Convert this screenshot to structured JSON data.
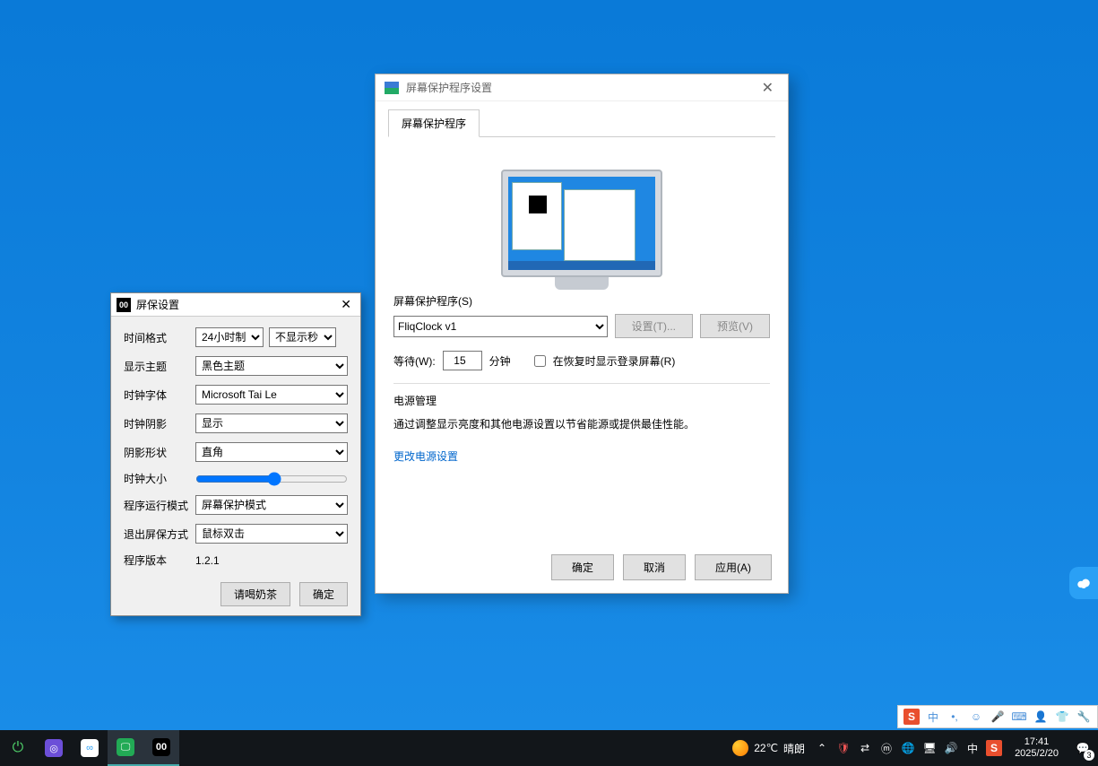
{
  "small_dialog": {
    "title": "屏保设置",
    "icon_text": "00",
    "rows": {
      "time_format": {
        "label": "时间格式",
        "value1": "24小时制",
        "value2": "不显示秒"
      },
      "theme": {
        "label": "显示主题",
        "value": "黑色主题"
      },
      "font": {
        "label": "时钟字体",
        "value": "Microsoft Tai Le"
      },
      "shadow": {
        "label": "时钟阴影",
        "value": "显示"
      },
      "shadow_shape": {
        "label": "阴影形状",
        "value": "直角"
      },
      "size": {
        "label": "时钟大小"
      },
      "run_mode": {
        "label": "程序运行模式",
        "value": "屏幕保护模式"
      },
      "exit_mode": {
        "label": "退出屏保方式",
        "value": "鼠标双击"
      },
      "version": {
        "label": "程序版本",
        "value": "1.2.1"
      }
    },
    "buttons": {
      "tea": "请喝奶茶",
      "ok": "确定"
    }
  },
  "win_dialog": {
    "title": "屏幕保护程序设置",
    "tab": "屏幕保护程序",
    "saver": {
      "label": "屏幕保护程序(S)",
      "selected": "FliqClock v1",
      "settings_btn": "设置(T)...",
      "preview_btn": "预览(V)"
    },
    "wait": {
      "label": "等待(W):",
      "value": "15",
      "unit": "分钟"
    },
    "resume": {
      "label": "在恢复时显示登录屏幕(R)"
    },
    "power": {
      "title": "电源管理",
      "desc": "通过调整显示亮度和其他电源设置以节省能源或提供最佳性能。",
      "link": "更改电源设置"
    },
    "buttons": {
      "ok": "确定",
      "cancel": "取消",
      "apply": "应用(A)"
    }
  },
  "ime": {
    "ch": "中"
  },
  "taskbar": {
    "weather": {
      "temp": "22℃",
      "cond": "晴朗"
    },
    "ime": "中",
    "clock": {
      "time": "17:41",
      "date": "2025/2/20"
    },
    "notif_count": "3"
  }
}
